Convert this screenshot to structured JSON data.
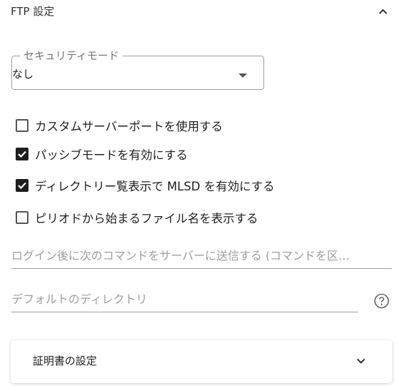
{
  "section": {
    "title": "FTP 設定",
    "collapse_icon": "chevron-up-icon"
  },
  "security_mode": {
    "label": "セキュリティモード",
    "value": "なし",
    "arrow_icon": "dropdown-arrow-icon"
  },
  "options": [
    {
      "label": "カスタムサーバーポートを使用する",
      "checked": false
    },
    {
      "label": "パッシブモードを有効にする",
      "checked": true
    },
    {
      "label": "ディレクトリー覧表示で MLSD を有効にする",
      "checked": true
    },
    {
      "label": "ピリオドから始まるファイル名を表示する",
      "checked": false
    }
  ],
  "commands_field": {
    "placeholder": "ログイン後に次のコマンドをサーバーに送信する (コマンドを区…",
    "value": ""
  },
  "default_directory_field": {
    "placeholder": "デフォルトのディレクトリ",
    "value": "",
    "help_icon": "help-circle-icon"
  },
  "certificate_panel": {
    "title": "証明書の設定",
    "expand_icon": "chevron-down-icon"
  },
  "colors": {
    "text": "#212121",
    "muted": "#757575",
    "border": "#9e9e9e",
    "checkbox_checked": "#1e1e1e"
  }
}
